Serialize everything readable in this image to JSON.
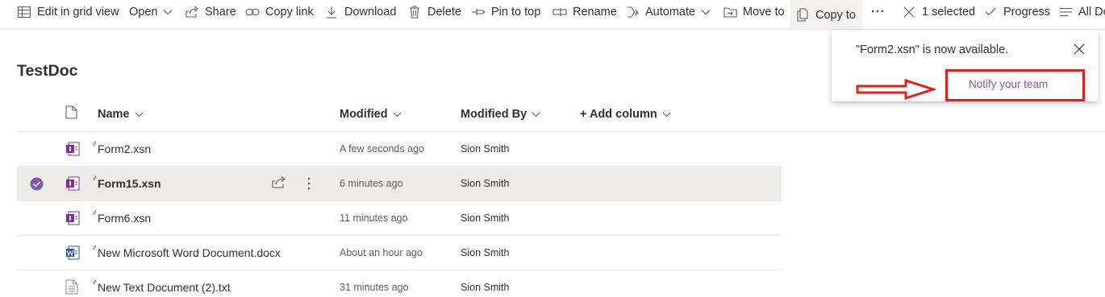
{
  "toolbar": {
    "edit_grid": "Edit in grid view",
    "open": "Open",
    "share": "Share",
    "copy_link": "Copy link",
    "download": "Download",
    "delete": "Delete",
    "pin": "Pin to top",
    "rename": "Rename",
    "automate": "Automate",
    "move_to": "Move to",
    "copy_to": "Copy to",
    "more": "···",
    "selected": "1 selected",
    "progress": "Progress",
    "all_docs": "All Documents"
  },
  "library": {
    "title": "TestDoc"
  },
  "columns": {
    "name": "Name",
    "modified": "Modified",
    "modified_by": "Modified By",
    "add_column": "+ Add column"
  },
  "files": [
    {
      "name": "Form2.xsn",
      "modified": "A few seconds ago",
      "modified_by": "Sion Smith",
      "type": "infopath-icon",
      "selected": false
    },
    {
      "name": "Form15.xsn",
      "modified": "6 minutes ago",
      "modified_by": "Sion Smith",
      "type": "infopath-icon",
      "selected": true
    },
    {
      "name": "Form6.xsn",
      "modified": "11 minutes ago",
      "modified_by": "Sion Smith",
      "type": "infopath-icon",
      "selected": false
    },
    {
      "name": "New Microsoft Word Document.docx",
      "modified": "About an hour ago",
      "modified_by": "Sion Smith",
      "type": "word-icon",
      "selected": false
    },
    {
      "name": "New Text Document (2).txt",
      "modified": "31 minutes ago",
      "modified_by": "Sion Smith",
      "type": "text-file-icon",
      "selected": false
    }
  ],
  "notification": {
    "message": "\"Form2.xsn\" is now available.",
    "action": "Notify your team"
  },
  "colors": {
    "accent": "#7a5ca8",
    "infopath": "#77359a",
    "word": "#2b579a",
    "annotation": "#e0201e"
  }
}
